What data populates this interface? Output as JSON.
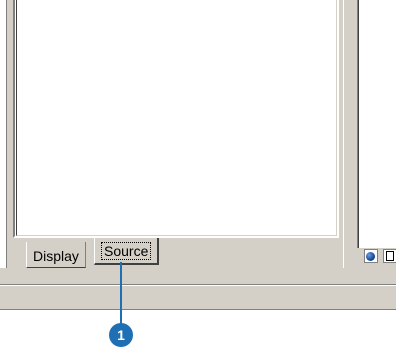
{
  "toc": {
    "tabs": [
      {
        "label": "Display",
        "selected": false
      },
      {
        "label": "Source",
        "selected": true
      }
    ]
  },
  "map_view": {
    "buttons": [
      {
        "icon": "globe-icon",
        "name": "data-view"
      },
      {
        "icon": "page-icon",
        "name": "layout-view"
      }
    ]
  },
  "callout": {
    "number": "1"
  },
  "colors": {
    "frame": "#d4d0c8",
    "callout": "#1f6fb5"
  }
}
